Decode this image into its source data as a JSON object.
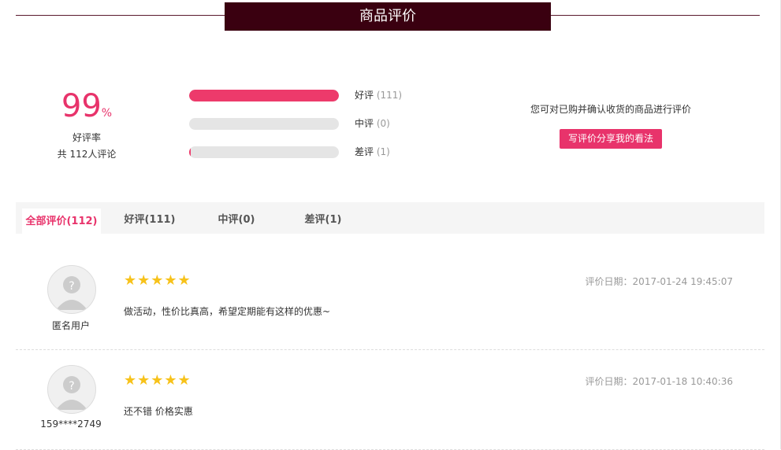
{
  "section": {
    "title": "商品评价"
  },
  "summary": {
    "rate_value": "99",
    "rate_unit": "%",
    "rate_label": "好评率",
    "total_text": "共 112人评论"
  },
  "bars": [
    {
      "label": "好评",
      "count": "(111)",
      "fraction": 1.0
    },
    {
      "label": "中评",
      "count": "(0)",
      "fraction": 0.0
    },
    {
      "label": "差评",
      "count": "(1)",
      "fraction": 0.009
    }
  ],
  "write": {
    "prompt": "您可对已购并确认收货的商品进行评价",
    "button": "写评价分享我的看法"
  },
  "tabs": [
    {
      "label": "全部评价(112)",
      "active": true
    },
    {
      "label": "好评(111)",
      "active": false
    },
    {
      "label": "中评(0)",
      "active": false
    },
    {
      "label": "差评(1)",
      "active": false
    }
  ],
  "reviews": [
    {
      "user": "匿名用户",
      "stars": "★★★★★",
      "text": "做活动，性价比真高，希望定期能有这样的优惠~",
      "date": "评价日期：2017-01-24 19:45:07"
    },
    {
      "user": "159****2749",
      "stars": "★★★★★",
      "text": "还不错 价格实惠",
      "date": "评价日期：2017-01-18 10:40:36"
    }
  ],
  "colors": {
    "accent": "#e8336b",
    "title_bg": "#3a0010",
    "star": "#f7c21a"
  },
  "icons": {
    "avatar": "avatar-placeholder-icon",
    "star": "star-icon"
  }
}
